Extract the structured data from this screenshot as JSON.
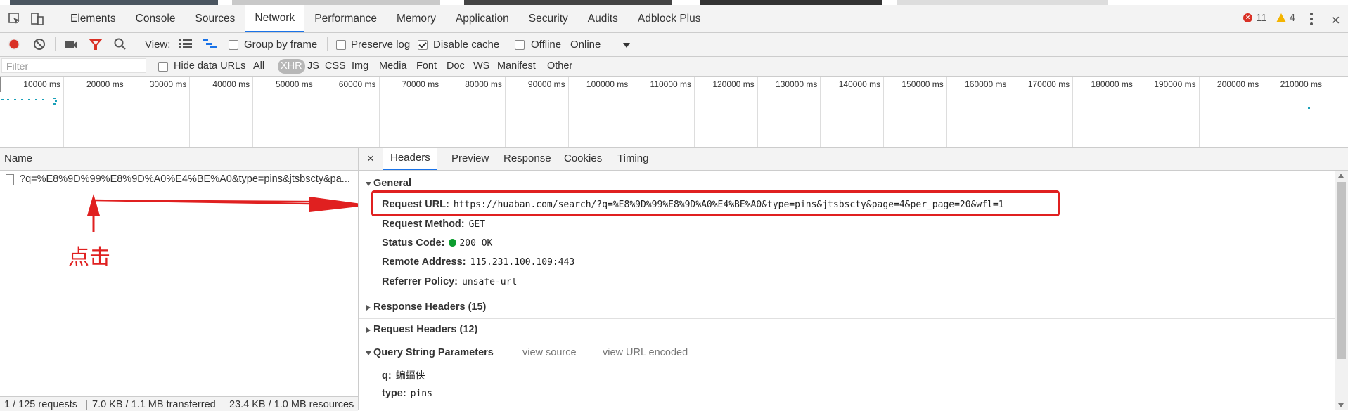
{
  "devtools": {
    "tabs": [
      "Elements",
      "Console",
      "Sources",
      "Network",
      "Performance",
      "Memory",
      "Application",
      "Security",
      "Audits",
      "Adblock Plus"
    ],
    "active_tab": "Network",
    "error_count": "11",
    "warning_count": "4"
  },
  "toolbar": {
    "view_label": "View:",
    "group_by_frame": "Group by frame",
    "preserve_log": "Preserve log",
    "disable_cache": "Disable cache",
    "offline": "Offline",
    "throttle": "Online"
  },
  "filterbar": {
    "placeholder": "Filter",
    "hide_data_urls": "Hide data URLs",
    "types": [
      "All",
      "XHR",
      "JS",
      "CSS",
      "Img",
      "Media",
      "Font",
      "Doc",
      "WS",
      "Manifest",
      "Other"
    ],
    "active_type": "XHR"
  },
  "overview": {
    "ticks": [
      "10000 ms",
      "20000 ms",
      "30000 ms",
      "40000 ms",
      "50000 ms",
      "60000 ms",
      "70000 ms",
      "80000 ms",
      "90000 ms",
      "100000 ms",
      "110000 ms",
      "120000 ms",
      "130000 ms",
      "140000 ms",
      "150000 ms",
      "160000 ms",
      "170000 ms",
      "180000 ms",
      "190000 ms",
      "200000 ms",
      "210000 ms"
    ]
  },
  "requests": {
    "column_name": "Name",
    "rows": [
      "?q=%E8%9D%99%E8%9D%A0%E4%BE%A0&type=pins&jtsbscty&pa..."
    ]
  },
  "annotation": {
    "text": "点击",
    "color": "#e02020"
  },
  "statusbar": {
    "requests": "1 / 125 requests",
    "transferred": "7.0 KB / 1.1 MB transferred",
    "resources": "23.4 KB / 1.0 MB resources"
  },
  "details": {
    "close": "×",
    "tabs": [
      "Headers",
      "Preview",
      "Response",
      "Cookies",
      "Timing"
    ],
    "active_tab": "Headers",
    "general_title": "General",
    "general": {
      "request_url_key": "Request URL:",
      "request_url": "https://huaban.com/search/?q=%E8%9D%99%E8%9D%A0%E4%BE%A0&type=pins&jtsbscty&page=4&per_page=20&wfl=1",
      "request_method_key": "Request Method:",
      "request_method": "GET",
      "status_code_key": "Status Code:",
      "status_code": "200 OK",
      "remote_address_key": "Remote Address:",
      "remote_address": "115.231.100.109:443",
      "referrer_policy_key": "Referrer Policy:",
      "referrer_policy": "unsafe-url"
    },
    "response_headers": "Response Headers (15)",
    "request_headers": "Request Headers (12)",
    "query_title": "Query String Parameters",
    "view_source": "view source",
    "view_url_encoded": "view URL encoded",
    "query": [
      {
        "key": "q:",
        "value": "蝙蝠侠"
      },
      {
        "key": "type:",
        "value": "pins"
      }
    ]
  }
}
